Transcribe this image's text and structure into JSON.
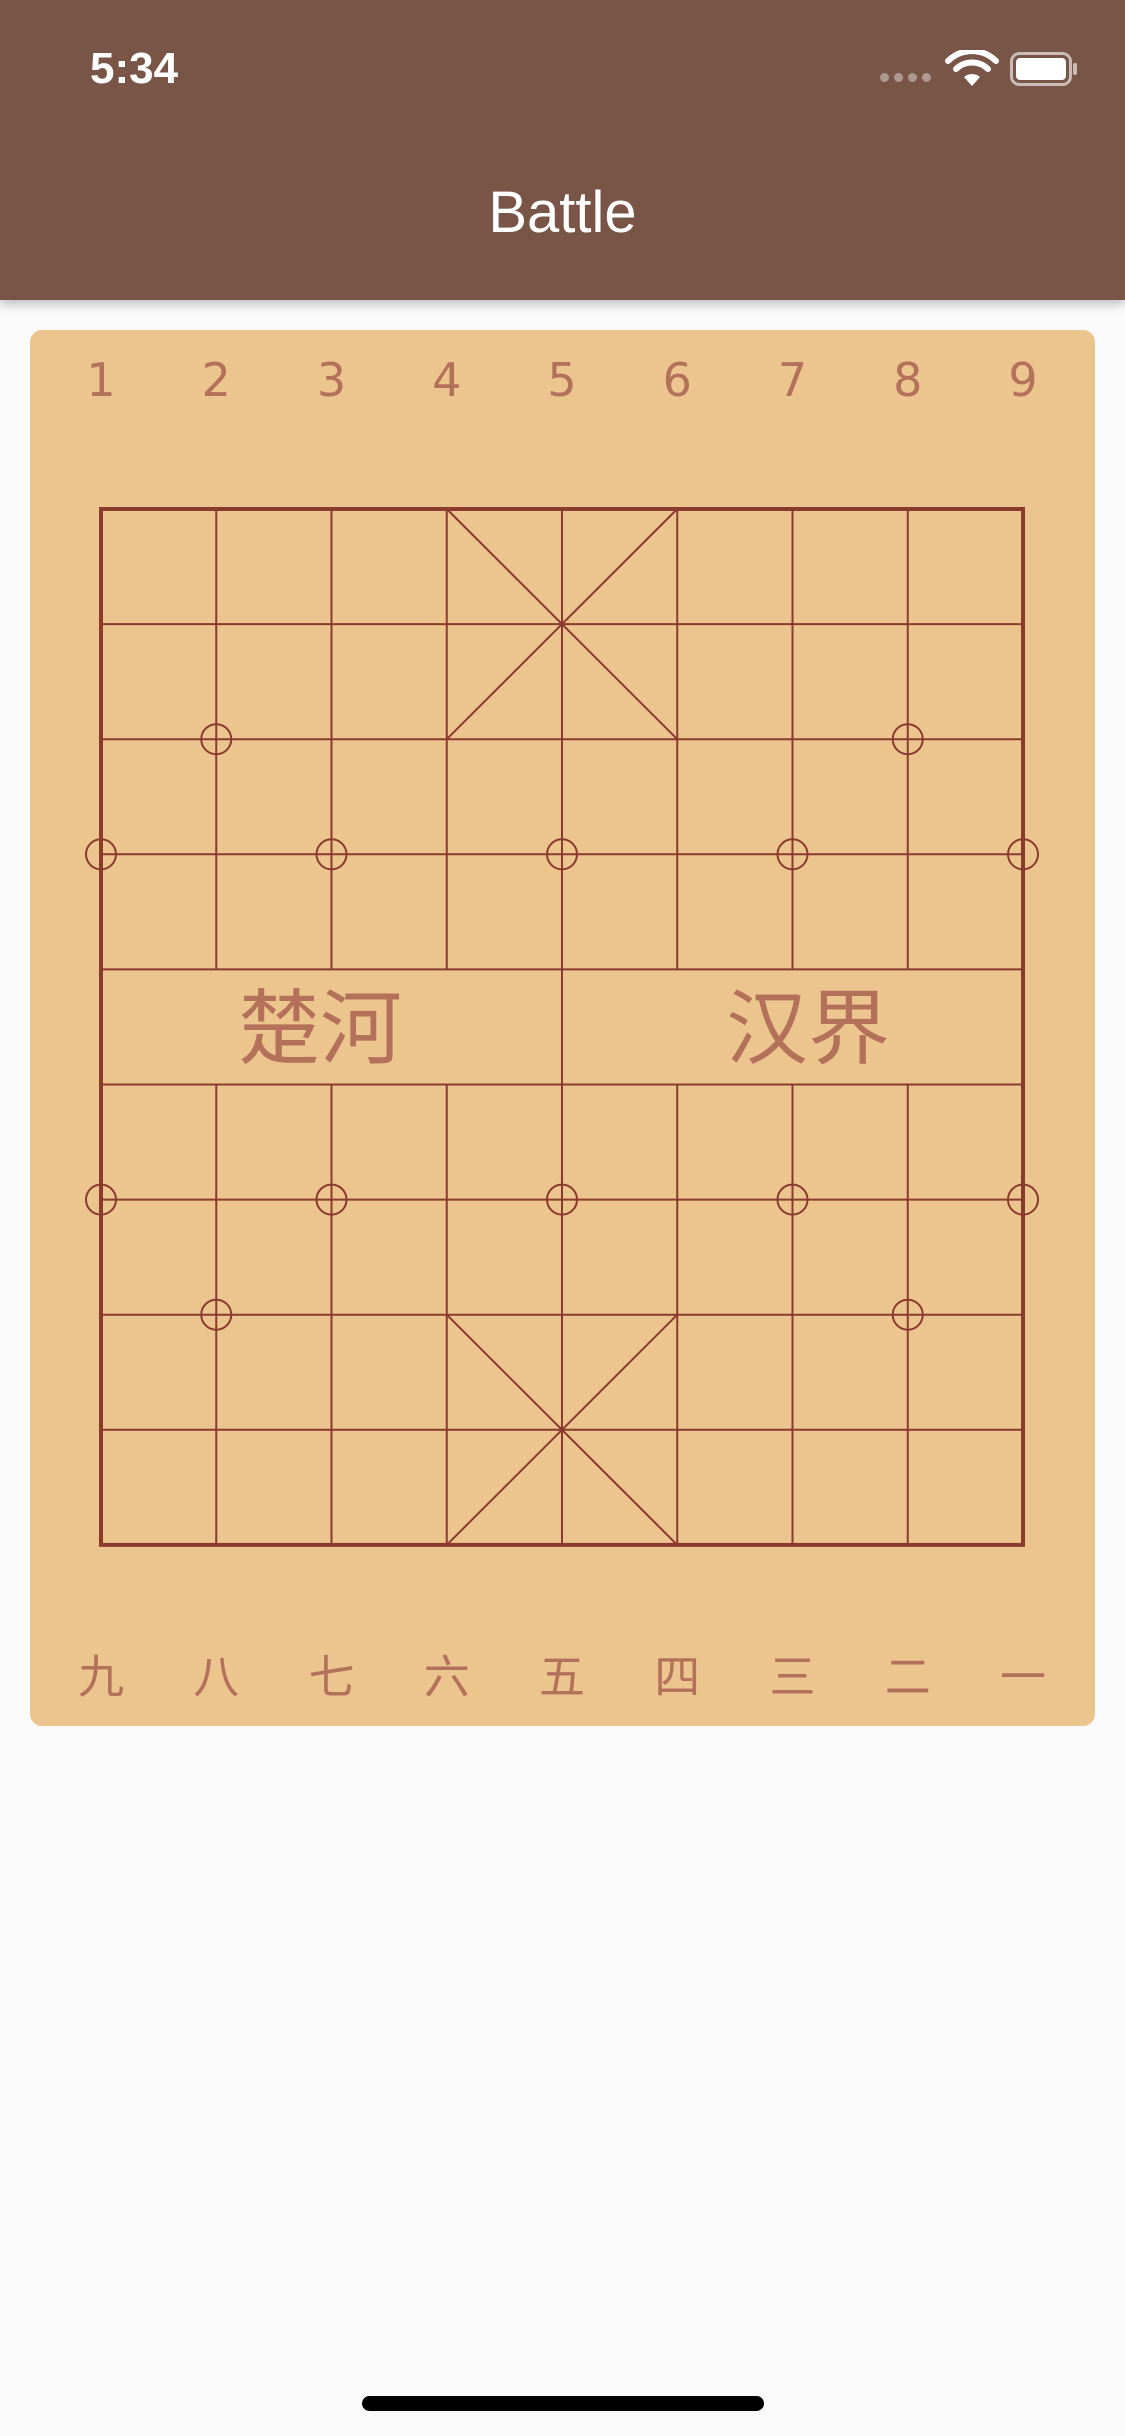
{
  "status_bar": {
    "time": "5:34",
    "icons": [
      "cellular-signal-icon",
      "wifi-icon",
      "battery-icon"
    ]
  },
  "app_bar": {
    "title": "Battle"
  },
  "board": {
    "top_labels": [
      "1",
      "2",
      "3",
      "4",
      "5",
      "6",
      "7",
      "8",
      "9"
    ],
    "bottom_labels": [
      "九",
      "八",
      "七",
      "六",
      "五",
      "四",
      "三",
      "二",
      "一"
    ],
    "river_left": "楚河",
    "river_right": "汉界",
    "colors": {
      "board_background": "#EBC48E",
      "grid_line": "#8B3A2E",
      "label_text": "#B4715A",
      "app_bar": "#795548"
    }
  }
}
